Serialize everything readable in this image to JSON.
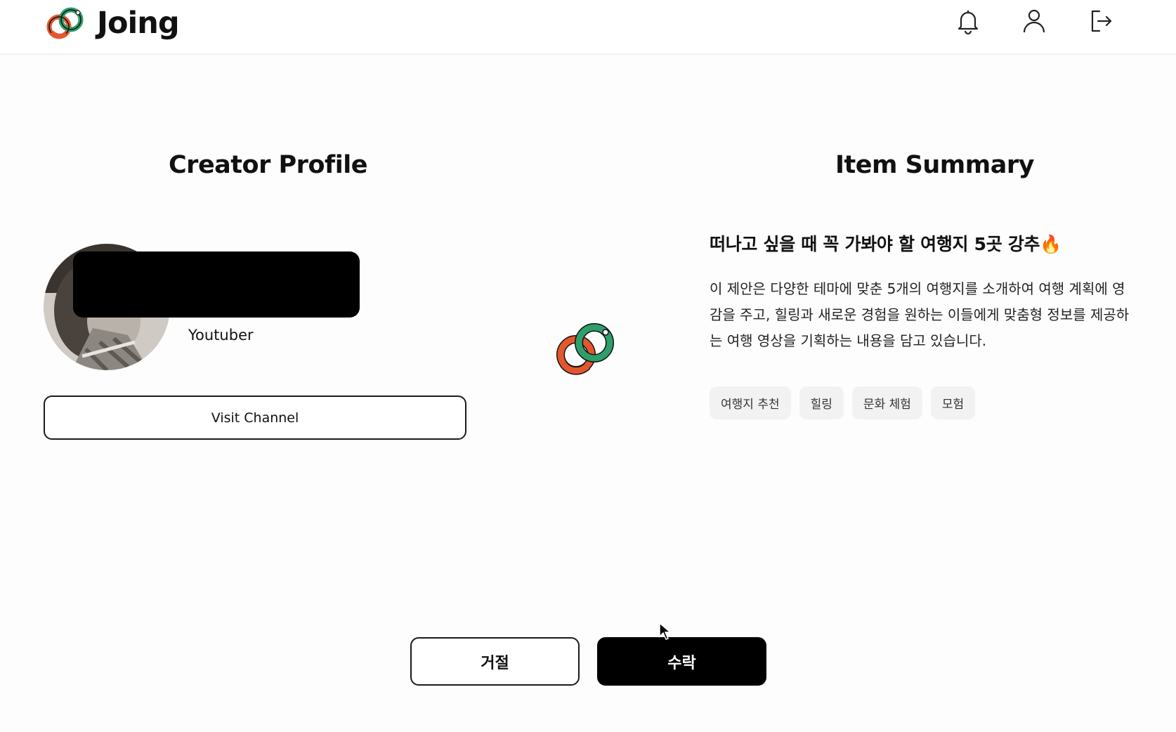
{
  "header": {
    "brand": "Joing",
    "icons": [
      "bell-icon",
      "user-icon",
      "logout-icon"
    ]
  },
  "creator": {
    "section_title": "Creator Profile",
    "role": "Youtuber",
    "visit_label": "Visit Channel"
  },
  "item": {
    "section_title": "Item Summary",
    "title": "떠나고 싶을 때 꼭 가봐야 할 여행지 5곳 강추🔥",
    "description": "이 제안은 다양한 테마에 맞춘 5개의 여행지를 소개하여 여행 계획에 영감을 주고, 힐링과 새로운 경험을 원하는 이들에게 맞춤형 정보를 제공하는 여행 영상을 기획하는 내용을 담고 있습니다.",
    "tags": [
      "여행지 추천",
      "힐링",
      "문화 체험",
      "모험"
    ]
  },
  "actions": {
    "reject_label": "거절",
    "accept_label": "수락"
  },
  "colors": {
    "logo_orange": "#e4572e",
    "logo_green": "#2e9e6b",
    "accent": "#000000"
  }
}
